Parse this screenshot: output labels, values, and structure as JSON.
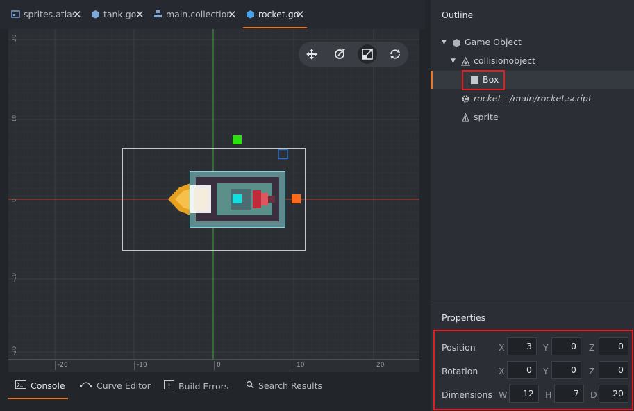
{
  "tabs": [
    {
      "label": "sprites.atlas",
      "icon": "atlas-icon"
    },
    {
      "label": "tank.go",
      "icon": "gameobject-icon"
    },
    {
      "label": "main.collection",
      "icon": "collection-icon"
    },
    {
      "label": "rocket.go",
      "icon": "gameobject-icon",
      "active": true
    }
  ],
  "tab_close_glyph": "✕",
  "viewport": {
    "y_ticks": [
      "20",
      "10",
      "0",
      "-10",
      "-20"
    ],
    "x_ticks": [
      "-20",
      "-10",
      "0",
      "10",
      "20"
    ]
  },
  "toolbar": {
    "buttons": [
      {
        "icon": "move-tool-icon"
      },
      {
        "icon": "rotate-tool-icon"
      },
      {
        "icon": "scale-tool-icon",
        "selected": true
      },
      {
        "icon": "rotate-camera-icon"
      }
    ]
  },
  "bottom_tabs": [
    {
      "label": "Console",
      "icon": "console-icon",
      "active": true
    },
    {
      "label": "Curve Editor",
      "icon": "curve-icon"
    },
    {
      "label": "Build Errors",
      "icon": "warning-icon"
    },
    {
      "label": "Search Results",
      "icon": "search-icon"
    }
  ],
  "outline": {
    "title": "Outline",
    "items": [
      {
        "label": "Game Object",
        "icon": "gameobject-icon",
        "expanded": true
      },
      {
        "label": "collisionobject",
        "icon": "collision-icon",
        "expanded": true
      },
      {
        "label": "Box",
        "icon": "box-shape-icon",
        "selected": true
      },
      {
        "label": "rocket - /main/rocket.script",
        "icon": "script-gear-icon"
      },
      {
        "label": "sprite",
        "icon": "sprite-icon"
      }
    ]
  },
  "properties": {
    "title": "Properties",
    "rows": [
      {
        "label": "Position",
        "axes": [
          "X",
          "Y",
          "Z"
        ],
        "values": [
          "3",
          "0",
          "0"
        ]
      },
      {
        "label": "Rotation",
        "axes": [
          "X",
          "Y",
          "Z"
        ],
        "values": [
          "0",
          "0",
          "0"
        ]
      },
      {
        "label": "Dimensions",
        "axes": [
          "W",
          "H",
          "D"
        ],
        "values": [
          "12",
          "7",
          "20"
        ]
      }
    ]
  },
  "colors": {
    "accent": "#e8762b",
    "highlight_box": "#e51c20",
    "x_axis": "#c0392b",
    "y_axis": "#3fa836",
    "handle_green": "#2ce012",
    "handle_orange": "#ff6a1a",
    "handle_cyan": "#12e0e0",
    "handle_blue": "#2a6fc8"
  }
}
